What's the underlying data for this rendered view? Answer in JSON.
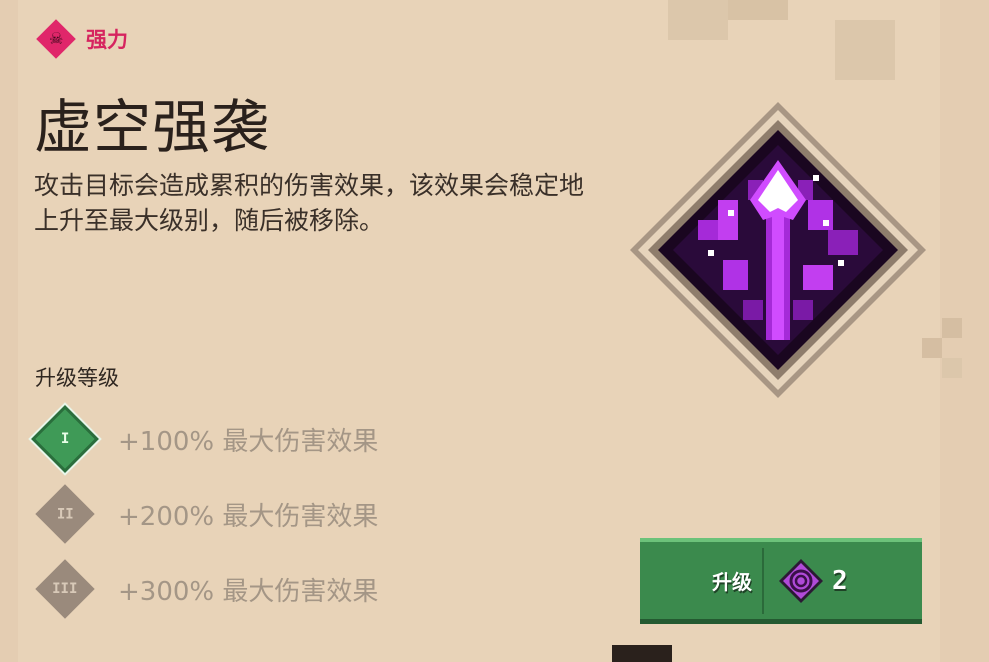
{
  "enchant": {
    "tag_icon": "skull-icon",
    "tag_label": "强力",
    "title": "虚空强袭",
    "description": "攻击目标会造成累积的伤害效果，该效果会稳定地上升至最大级别，随后被移除。"
  },
  "upgrades": {
    "heading": "升级等级",
    "tiers": [
      {
        "numeral": "I",
        "text": "+100% 最大伤害效果",
        "unlocked": true
      },
      {
        "numeral": "II",
        "text": "+200% 最大伤害效果",
        "unlocked": false
      },
      {
        "numeral": "III",
        "text": "+300% 最大伤害效果",
        "unlocked": false
      }
    ]
  },
  "button": {
    "label": "升级",
    "cost": "2",
    "cost_icon": "enchantment-point-icon"
  },
  "colors": {
    "tag": "#e0266a",
    "button": "#3b8a4d",
    "unlocked_tier": "#3f9a57",
    "locked_tier": "#9a8a7c",
    "art_purple": "#a52ad8"
  }
}
